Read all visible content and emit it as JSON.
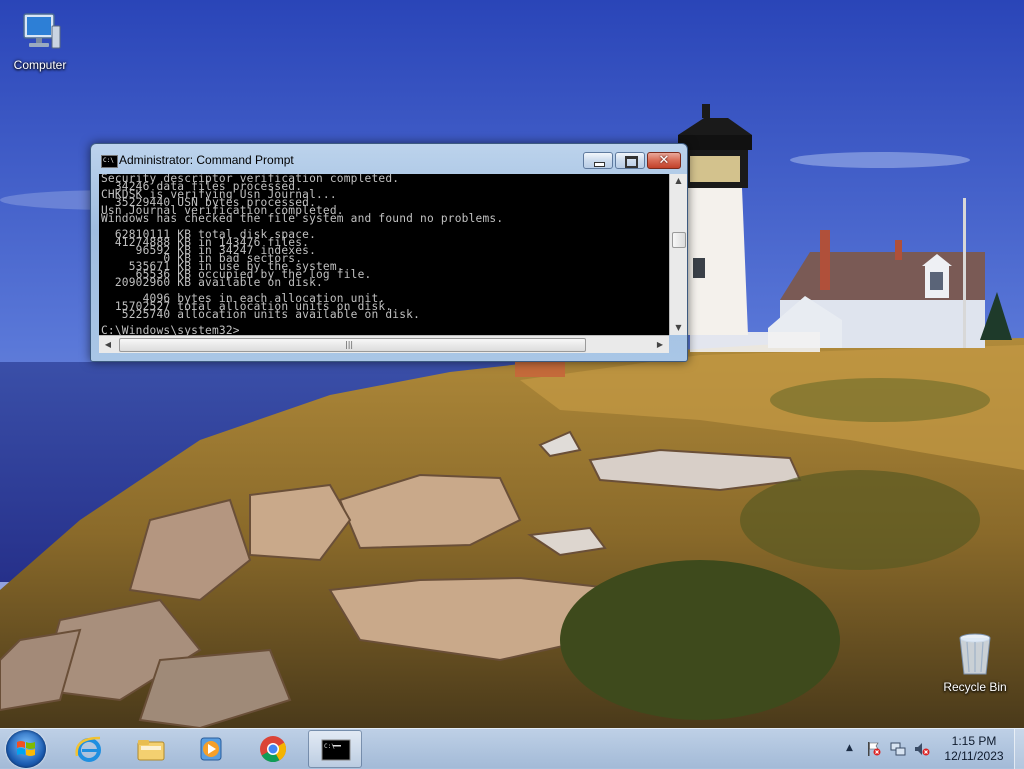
{
  "desktop": {
    "icons": [
      {
        "label": "Computer",
        "icon": "computer-icon"
      },
      {
        "label": "Recycle Bin",
        "icon": "recycle-bin-icon"
      }
    ]
  },
  "window": {
    "title": "Administrator:  Command Prompt",
    "app_icon_text": "C:\\",
    "buttons": {
      "minimize": "minimize",
      "maximize": "maximize",
      "close": "✕"
    },
    "console_lines": [
      "Security descriptor verification completed.",
      "  34246 data files processed.",
      "CHKDSK is verifying Usn Journal...",
      "  35229440 USN bytes processed.",
      "Usn Journal verification completed.",
      "Windows has checked the file system and found no problems.",
      "",
      "  62810111 KB total disk space.",
      "  41274888 KB in 143476 files.",
      "     96592 KB in 34247 indexes.",
      "         0 KB in bad sectors.",
      "    535671 KB in use by the system.",
      "     65536 KB occupied by the log file.",
      "  20902960 KB available on disk.",
      "",
      "      4096 bytes in each allocation unit.",
      "  15702527 total allocation units on disk.",
      "   5225740 allocation units available on disk.",
      "",
      "C:\\Windows\\system32>_"
    ]
  },
  "taskbar": {
    "start": "start-button",
    "pinned": [
      {
        "name": "Internet Explorer",
        "icon": "internet-explorer-icon"
      },
      {
        "name": "Windows Explorer",
        "icon": "folder-icon"
      },
      {
        "name": "Windows Media Player",
        "icon": "media-player-icon"
      },
      {
        "name": "Google Chrome",
        "icon": "chrome-icon"
      },
      {
        "name": "Command Prompt",
        "icon": "cmd-icon",
        "active": true
      }
    ],
    "tray": {
      "show_hidden": "▲",
      "icons": [
        "action-center-flag-icon",
        "network-icon",
        "volume-muted-icon"
      ],
      "time": "1:15 PM",
      "date": "12/11/2023"
    }
  },
  "colors": {
    "console_bg": "#000000",
    "console_text": "#C0C0C0",
    "close_button": "#C9452E"
  }
}
